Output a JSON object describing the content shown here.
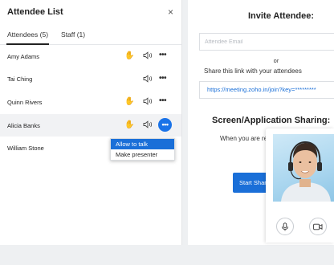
{
  "attendee_panel": {
    "title": "Attendee List",
    "close_glyph": "×",
    "tabs": [
      {
        "label": "Attendees (5)",
        "active": true
      },
      {
        "label": "Staff (1)",
        "active": false
      }
    ],
    "attendees": [
      {
        "name": "Amy Adams",
        "hand_raised": true,
        "speaker": true,
        "more": true
      },
      {
        "name": "Tai Ching",
        "hand_raised": false,
        "speaker": true,
        "more": true
      },
      {
        "name": "Quinn Rivers",
        "hand_raised": true,
        "speaker": true,
        "more": true
      },
      {
        "name": "Alicia Banks",
        "hand_raised": true,
        "speaker": true,
        "more": true,
        "menu_open": true
      },
      {
        "name": "William Stone",
        "hand_raised": false,
        "speaker": false,
        "more": false
      }
    ],
    "more_glyph": "•••",
    "hand_icon": "raised-hand-icon",
    "context_menu": {
      "items": [
        {
          "label": "Allow to talk",
          "selected": true
        },
        {
          "label": "Make presenter",
          "selected": false
        }
      ]
    }
  },
  "invite_panel": {
    "title": "Invite Attendee:",
    "email_placeholder": "Attendee Email",
    "or_text": "or",
    "share_text": "Share this link with your attendees",
    "link": "https://meeting.zoho.in/join?key=*********",
    "screen_title": "Screen/Application Sharing:",
    "screen_desc": "When you are ready to share your screen",
    "start_button": "Start Sharing"
  },
  "video_tile": {
    "mic_icon": "microphone-icon",
    "camera_icon": "video-camera-icon"
  },
  "colors": {
    "accent": "#1a6fd8",
    "hand": "#f08a1c",
    "background": "#eef0f2"
  }
}
